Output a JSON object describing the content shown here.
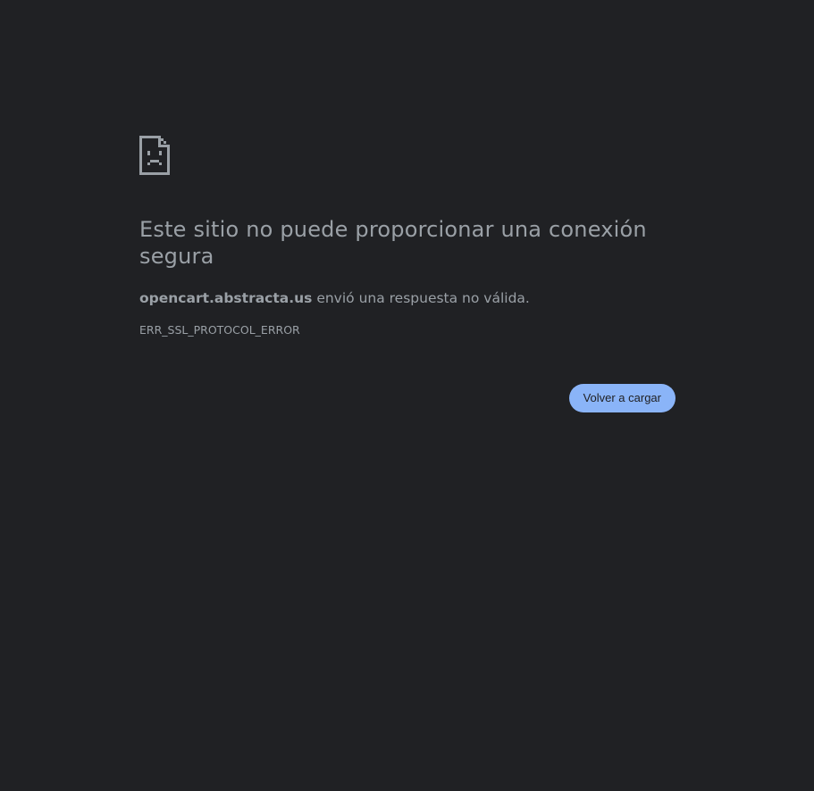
{
  "error": {
    "title": "Este sitio no puede proporcionar una conexión segura",
    "host": "opencart.abstracta.us",
    "message": " envió una respuesta no válida.",
    "code": "ERR_SSL_PROTOCOL_ERROR",
    "icon": "sad-document-icon"
  },
  "actions": {
    "reload_label": "Volver a cargar"
  },
  "colors": {
    "background": "#202124",
    "text": "#9aa0a6",
    "button": "#8ab4f8"
  }
}
